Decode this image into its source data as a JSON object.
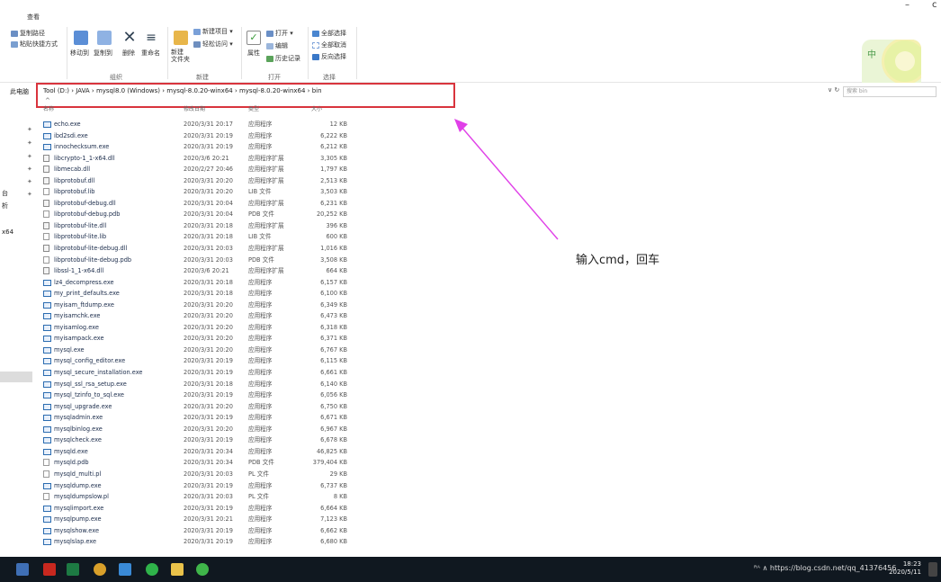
{
  "window": {
    "minimize": "–",
    "restore": "c"
  },
  "ribbon": {
    "tab": "查看",
    "clipboard": {
      "copy_path": "复制路径",
      "paste_shortcut": "粘贴快捷方式",
      "group": "组织"
    },
    "organize": {
      "move_to": "移动到",
      "copy_to": "复制到",
      "delete": "删除",
      "rename": "重命名"
    },
    "new": {
      "new_item": "新建项目 ▾",
      "easy_access": "轻松访问 ▾",
      "new_folder": "新建\n文件夹",
      "group": "新建"
    },
    "open": {
      "properties": "属性",
      "open": "打开 ▾",
      "edit": "编辑",
      "history": "历史记录",
      "group": "打开"
    },
    "select": {
      "select_all": "全部选择",
      "select_none": "全部取消",
      "invert": "反向选择",
      "group": "选择"
    },
    "deco_char": "中"
  },
  "address": {
    "left_label": "此电脑",
    "crumbs": "Tool (D:)  ›  JAVA  ›  mysql8.0 (Windows)  ›  mysql-8.0.20-winx64  ›  mysql-8.0.20-winx64  ›  bin",
    "refresh": "∨ ↻",
    "search_placeholder": "搜索 bin"
  },
  "nav": {
    "items": [
      "台",
      "析",
      "x64"
    ]
  },
  "columns": {
    "name": "名称",
    "date": "修改日期",
    "type": "类型",
    "size": "大小"
  },
  "files": [
    {
      "icon": "exe",
      "name": "echo.exe",
      "date": "2020/3/31 20:17",
      "type": "应用程序",
      "size": "12 KB"
    },
    {
      "icon": "exe",
      "name": "ibd2sdi.exe",
      "date": "2020/3/31 20:19",
      "type": "应用程序",
      "size": "6,222 KB"
    },
    {
      "icon": "exe",
      "name": "innochecksum.exe",
      "date": "2020/3/31 20:19",
      "type": "应用程序",
      "size": "6,212 KB"
    },
    {
      "icon": "dll",
      "name": "libcrypto-1_1-x64.dll",
      "date": "2020/3/6 20:21",
      "type": "应用程序扩展",
      "size": "3,305 KB"
    },
    {
      "icon": "dll",
      "name": "libmecab.dll",
      "date": "2020/2/27 20:46",
      "type": "应用程序扩展",
      "size": "1,797 KB"
    },
    {
      "icon": "dll",
      "name": "libprotobuf.dll",
      "date": "2020/3/31 20:20",
      "type": "应用程序扩展",
      "size": "2,513 KB"
    },
    {
      "icon": "doc",
      "name": "libprotobuf.lib",
      "date": "2020/3/31 20:20",
      "type": "LIB 文件",
      "size": "3,503 KB"
    },
    {
      "icon": "dll",
      "name": "libprotobuf-debug.dll",
      "date": "2020/3/31 20:04",
      "type": "应用程序扩展",
      "size": "6,231 KB"
    },
    {
      "icon": "doc",
      "name": "libprotobuf-debug.pdb",
      "date": "2020/3/31 20:04",
      "type": "PDB 文件",
      "size": "20,252 KB"
    },
    {
      "icon": "dll",
      "name": "libprotobuf-lite.dll",
      "date": "2020/3/31 20:18",
      "type": "应用程序扩展",
      "size": "396 KB"
    },
    {
      "icon": "doc",
      "name": "libprotobuf-lite.lib",
      "date": "2020/3/31 20:18",
      "type": "LIB 文件",
      "size": "600 KB"
    },
    {
      "icon": "dll",
      "name": "libprotobuf-lite-debug.dll",
      "date": "2020/3/31 20:03",
      "type": "应用程序扩展",
      "size": "1,016 KB"
    },
    {
      "icon": "doc",
      "name": "libprotobuf-lite-debug.pdb",
      "date": "2020/3/31 20:03",
      "type": "PDB 文件",
      "size": "3,508 KB"
    },
    {
      "icon": "dll",
      "name": "libssl-1_1-x64.dll",
      "date": "2020/3/6 20:21",
      "type": "应用程序扩展",
      "size": "664 KB"
    },
    {
      "icon": "exe",
      "name": "lz4_decompress.exe",
      "date": "2020/3/31 20:18",
      "type": "应用程序",
      "size": "6,157 KB"
    },
    {
      "icon": "exe",
      "name": "my_print_defaults.exe",
      "date": "2020/3/31 20:18",
      "type": "应用程序",
      "size": "6,100 KB"
    },
    {
      "icon": "exe",
      "name": "myisam_ftdump.exe",
      "date": "2020/3/31 20:20",
      "type": "应用程序",
      "size": "6,349 KB"
    },
    {
      "icon": "exe",
      "name": "myisamchk.exe",
      "date": "2020/3/31 20:20",
      "type": "应用程序",
      "size": "6,473 KB"
    },
    {
      "icon": "exe",
      "name": "myisamlog.exe",
      "date": "2020/3/31 20:20",
      "type": "应用程序",
      "size": "6,318 KB"
    },
    {
      "icon": "exe",
      "name": "myisampack.exe",
      "date": "2020/3/31 20:20",
      "type": "应用程序",
      "size": "6,371 KB"
    },
    {
      "icon": "exe",
      "name": "mysql.exe",
      "date": "2020/3/31 20:20",
      "type": "应用程序",
      "size": "6,767 KB"
    },
    {
      "icon": "exe",
      "name": "mysql_config_editor.exe",
      "date": "2020/3/31 20:19",
      "type": "应用程序",
      "size": "6,115 KB"
    },
    {
      "icon": "exe",
      "name": "mysql_secure_installation.exe",
      "date": "2020/3/31 20:19",
      "type": "应用程序",
      "size": "6,661 KB"
    },
    {
      "icon": "exe",
      "name": "mysql_ssl_rsa_setup.exe",
      "date": "2020/3/31 20:18",
      "type": "应用程序",
      "size": "6,140 KB"
    },
    {
      "icon": "exe",
      "name": "mysql_tzinfo_to_sql.exe",
      "date": "2020/3/31 20:19",
      "type": "应用程序",
      "size": "6,056 KB"
    },
    {
      "icon": "exe",
      "name": "mysql_upgrade.exe",
      "date": "2020/3/31 20:20",
      "type": "应用程序",
      "size": "6,750 KB"
    },
    {
      "icon": "exe",
      "name": "mysqladmin.exe",
      "date": "2020/3/31 20:19",
      "type": "应用程序",
      "size": "6,671 KB"
    },
    {
      "icon": "exe",
      "name": "mysqlbinlog.exe",
      "date": "2020/3/31 20:20",
      "type": "应用程序",
      "size": "6,967 KB"
    },
    {
      "icon": "exe",
      "name": "mysqlcheck.exe",
      "date": "2020/3/31 20:19",
      "type": "应用程序",
      "size": "6,678 KB"
    },
    {
      "icon": "exe",
      "name": "mysqld.exe",
      "date": "2020/3/31 20:34",
      "type": "应用程序",
      "size": "46,825 KB"
    },
    {
      "icon": "doc",
      "name": "mysqld.pdb",
      "date": "2020/3/31 20:34",
      "type": "PDB 文件",
      "size": "379,404 KB"
    },
    {
      "icon": "doc",
      "name": "mysqld_multi.pl",
      "date": "2020/3/31 20:03",
      "type": "PL 文件",
      "size": "29 KB"
    },
    {
      "icon": "exe",
      "name": "mysqldump.exe",
      "date": "2020/3/31 20:19",
      "type": "应用程序",
      "size": "6,737 KB"
    },
    {
      "icon": "doc",
      "name": "mysqldumpslow.pl",
      "date": "2020/3/31 20:03",
      "type": "PL 文件",
      "size": "8 KB"
    },
    {
      "icon": "exe",
      "name": "mysqlimport.exe",
      "date": "2020/3/31 20:19",
      "type": "应用程序",
      "size": "6,664 KB"
    },
    {
      "icon": "exe",
      "name": "mysqlpump.exe",
      "date": "2020/3/31 20:21",
      "type": "应用程序",
      "size": "7,123 KB"
    },
    {
      "icon": "exe",
      "name": "mysqlshow.exe",
      "date": "2020/3/31 20:19",
      "type": "应用程序",
      "size": "6,662 KB"
    },
    {
      "icon": "exe",
      "name": "mysqlslap.exe",
      "date": "2020/3/31 20:19",
      "type": "应用程序",
      "size": "6,680 KB"
    }
  ],
  "annotation": {
    "text": "输入cmd，回车",
    "color": "#e040e8"
  },
  "highlight_color": "#d9343d",
  "taskbar": {
    "tray": "ᴿᴬ  ∧  https://blog.csdn.net/qq_41376456",
    "time": "18:23",
    "date": "2020/5/11"
  }
}
